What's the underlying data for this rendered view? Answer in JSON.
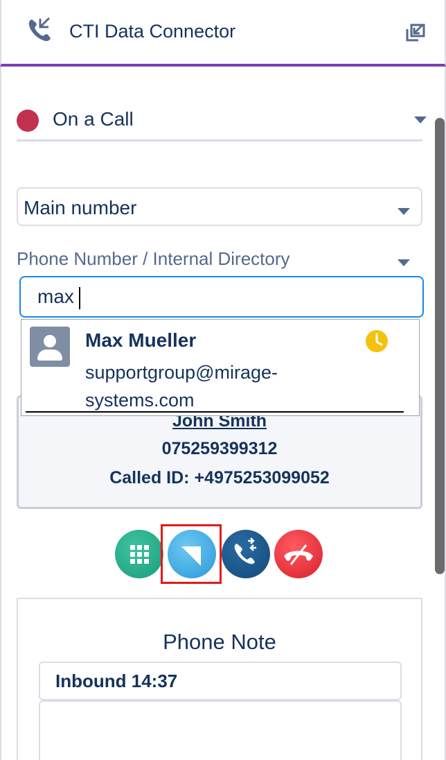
{
  "header": {
    "title": "CTI Data Connector",
    "phone_icon": "phone-incoming-icon",
    "popout_icon": "popout-icon"
  },
  "status": {
    "label": "On a Call",
    "color": "#c23150"
  },
  "line_select": {
    "value": "Main number"
  },
  "directory": {
    "label": "Phone Number / Internal Directory",
    "search_value": "max"
  },
  "search_results": [
    {
      "name": "Max Mueller",
      "email": "supportgroup@mirage-systems.com",
      "status_icon": "clock-icon",
      "status_color": "#f4c20d"
    }
  ],
  "current_call": {
    "caller_name": "John Smith",
    "caller_number": "075259399312",
    "called_id": "Called ID: +4975253099052"
  },
  "call_controls": [
    {
      "name": "dialpad",
      "icon": "dialpad-icon",
      "color": "#1a9c7b"
    },
    {
      "name": "transfer",
      "icon": "transfer-icon",
      "color": "#2a99d8"
    },
    {
      "name": "consult",
      "icon": "consult-call-icon",
      "color": "#124a7c"
    },
    {
      "name": "hangup",
      "icon": "hangup-icon",
      "color": "#d8202b"
    }
  ],
  "phone_note": {
    "title": "Phone Note",
    "subject": "Inbound 14:37",
    "body": ""
  },
  "colors": {
    "accent": "#7b3fb3",
    "text": "#16325c",
    "focus": "#1589ee",
    "highlight": "#e11a1a"
  }
}
